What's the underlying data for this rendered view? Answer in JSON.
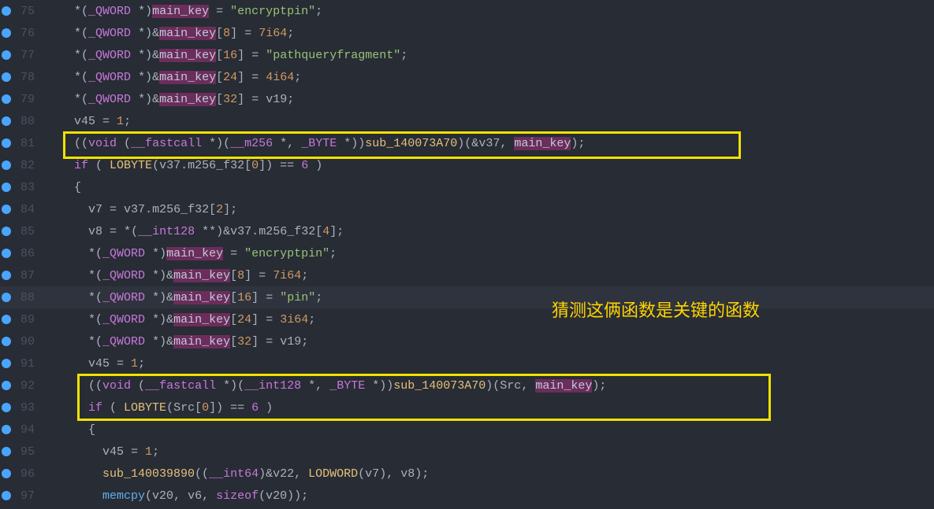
{
  "annotation_text": "猜测这俩函数是关键的函数",
  "lines": [
    {
      "n": 75,
      "indent": 2,
      "tokens": [
        {
          "t": "op",
          "v": "*"
        },
        {
          "t": "punc",
          "v": "("
        },
        {
          "t": "type",
          "v": "_QWORD"
        },
        {
          "t": "punc",
          "v": " "
        },
        {
          "t": "op",
          "v": "*"
        },
        {
          "t": "punc",
          "v": ")"
        },
        {
          "t": "hl1",
          "v": "main_key"
        },
        {
          "t": "op",
          "v": " = "
        },
        {
          "t": "str",
          "v": "\"encryptpin\""
        },
        {
          "t": "punc",
          "v": ";"
        }
      ]
    },
    {
      "n": 76,
      "indent": 2,
      "tokens": [
        {
          "t": "op",
          "v": "*"
        },
        {
          "t": "punc",
          "v": "("
        },
        {
          "t": "type",
          "v": "_QWORD"
        },
        {
          "t": "punc",
          "v": " "
        },
        {
          "t": "op",
          "v": "*"
        },
        {
          "t": "punc",
          "v": ")"
        },
        {
          "t": "op",
          "v": "&"
        },
        {
          "t": "hl1",
          "v": "main_key"
        },
        {
          "t": "punc",
          "v": "["
        },
        {
          "t": "num",
          "v": "8"
        },
        {
          "t": "punc",
          "v": "]"
        },
        {
          "t": "op",
          "v": " = "
        },
        {
          "t": "num",
          "v": "7i64"
        },
        {
          "t": "punc",
          "v": ";"
        }
      ]
    },
    {
      "n": 77,
      "indent": 2,
      "tokens": [
        {
          "t": "op",
          "v": "*"
        },
        {
          "t": "punc",
          "v": "("
        },
        {
          "t": "type",
          "v": "_QWORD"
        },
        {
          "t": "punc",
          "v": " "
        },
        {
          "t": "op",
          "v": "*"
        },
        {
          "t": "punc",
          "v": ")"
        },
        {
          "t": "op",
          "v": "&"
        },
        {
          "t": "hl1",
          "v": "main_key"
        },
        {
          "t": "punc",
          "v": "["
        },
        {
          "t": "num",
          "v": "16"
        },
        {
          "t": "punc",
          "v": "]"
        },
        {
          "t": "op",
          "v": " = "
        },
        {
          "t": "str",
          "v": "\"pathqueryfragment\""
        },
        {
          "t": "punc",
          "v": ";"
        }
      ]
    },
    {
      "n": 78,
      "indent": 2,
      "tokens": [
        {
          "t": "op",
          "v": "*"
        },
        {
          "t": "punc",
          "v": "("
        },
        {
          "t": "type",
          "v": "_QWORD"
        },
        {
          "t": "punc",
          "v": " "
        },
        {
          "t": "op",
          "v": "*"
        },
        {
          "t": "punc",
          "v": ")"
        },
        {
          "t": "op",
          "v": "&"
        },
        {
          "t": "hl1",
          "v": "main_key"
        },
        {
          "t": "punc",
          "v": "["
        },
        {
          "t": "num",
          "v": "24"
        },
        {
          "t": "punc",
          "v": "]"
        },
        {
          "t": "op",
          "v": " = "
        },
        {
          "t": "num",
          "v": "4i64"
        },
        {
          "t": "punc",
          "v": ";"
        }
      ]
    },
    {
      "n": 79,
      "indent": 2,
      "tokens": [
        {
          "t": "op",
          "v": "*"
        },
        {
          "t": "punc",
          "v": "("
        },
        {
          "t": "type",
          "v": "_QWORD"
        },
        {
          "t": "punc",
          "v": " "
        },
        {
          "t": "op",
          "v": "*"
        },
        {
          "t": "punc",
          "v": ")"
        },
        {
          "t": "op",
          "v": "&"
        },
        {
          "t": "hl1",
          "v": "main_key"
        },
        {
          "t": "punc",
          "v": "["
        },
        {
          "t": "num",
          "v": "32"
        },
        {
          "t": "punc",
          "v": "]"
        },
        {
          "t": "op",
          "v": " = "
        },
        {
          "t": "var",
          "v": "v19"
        },
        {
          "t": "punc",
          "v": ";"
        }
      ]
    },
    {
      "n": 80,
      "indent": 2,
      "tokens": [
        {
          "t": "var",
          "v": "v45"
        },
        {
          "t": "op",
          "v": " = "
        },
        {
          "t": "num",
          "v": "1"
        },
        {
          "t": "punc",
          "v": ";"
        }
      ]
    },
    {
      "n": 81,
      "indent": 2,
      "tokens": [
        {
          "t": "punc",
          "v": "(("
        },
        {
          "t": "kw",
          "v": "void"
        },
        {
          "t": "punc",
          "v": " ("
        },
        {
          "t": "kw",
          "v": "__fastcall"
        },
        {
          "t": "punc",
          "v": " "
        },
        {
          "t": "op",
          "v": "*"
        },
        {
          "t": "punc",
          "v": ")("
        },
        {
          "t": "type",
          "v": "__m256"
        },
        {
          "t": "punc",
          "v": " "
        },
        {
          "t": "op",
          "v": "*"
        },
        {
          "t": "punc",
          "v": ", "
        },
        {
          "t": "type",
          "v": "_BYTE"
        },
        {
          "t": "punc",
          "v": " "
        },
        {
          "t": "op",
          "v": "*"
        },
        {
          "t": "punc",
          "v": "))"
        },
        {
          "t": "gfunc",
          "v": "sub_140073A70"
        },
        {
          "t": "punc",
          "v": ")("
        },
        {
          "t": "op",
          "v": "&"
        },
        {
          "t": "var",
          "v": "v37"
        },
        {
          "t": "punc",
          "v": ", "
        },
        {
          "t": "hl1",
          "v": "main_key"
        },
        {
          "t": "punc",
          "v": ");"
        }
      ]
    },
    {
      "n": 82,
      "indent": 2,
      "tokens": [
        {
          "t": "kw",
          "v": "if"
        },
        {
          "t": "punc",
          "v": " ( "
        },
        {
          "t": "macro",
          "v": "LOBYTE"
        },
        {
          "t": "punc",
          "v": "("
        },
        {
          "t": "var",
          "v": "v37"
        },
        {
          "t": "punc",
          "v": "."
        },
        {
          "t": "var",
          "v": "m256_f32"
        },
        {
          "t": "punc",
          "v": "["
        },
        {
          "t": "num",
          "v": "0"
        },
        {
          "t": "punc",
          "v": "])"
        },
        {
          "t": "op",
          "v": " == "
        },
        {
          "t": "eq6",
          "v": "6"
        },
        {
          "t": "punc",
          "v": " )"
        }
      ]
    },
    {
      "n": 83,
      "indent": 2,
      "tokens": [
        {
          "t": "punc",
          "v": "{"
        }
      ]
    },
    {
      "n": 84,
      "indent": 3,
      "tokens": [
        {
          "t": "var",
          "v": "v7"
        },
        {
          "t": "op",
          "v": " = "
        },
        {
          "t": "var",
          "v": "v37"
        },
        {
          "t": "punc",
          "v": "."
        },
        {
          "t": "var",
          "v": "m256_f32"
        },
        {
          "t": "punc",
          "v": "["
        },
        {
          "t": "num",
          "v": "2"
        },
        {
          "t": "punc",
          "v": "];"
        }
      ]
    },
    {
      "n": 85,
      "indent": 3,
      "tokens": [
        {
          "t": "var",
          "v": "v8"
        },
        {
          "t": "op",
          "v": " = "
        },
        {
          "t": "op",
          "v": "*"
        },
        {
          "t": "punc",
          "v": "("
        },
        {
          "t": "type",
          "v": "__int128"
        },
        {
          "t": "punc",
          "v": " "
        },
        {
          "t": "op",
          "v": "**"
        },
        {
          "t": "punc",
          "v": ")"
        },
        {
          "t": "op",
          "v": "&"
        },
        {
          "t": "var",
          "v": "v37"
        },
        {
          "t": "punc",
          "v": "."
        },
        {
          "t": "var",
          "v": "m256_f32"
        },
        {
          "t": "punc",
          "v": "["
        },
        {
          "t": "num",
          "v": "4"
        },
        {
          "t": "punc",
          "v": "];"
        }
      ]
    },
    {
      "n": 86,
      "indent": 3,
      "tokens": [
        {
          "t": "op",
          "v": "*"
        },
        {
          "t": "punc",
          "v": "("
        },
        {
          "t": "type",
          "v": "_QWORD"
        },
        {
          "t": "punc",
          "v": " "
        },
        {
          "t": "op",
          "v": "*"
        },
        {
          "t": "punc",
          "v": ")"
        },
        {
          "t": "hl1",
          "v": "main_key"
        },
        {
          "t": "op",
          "v": " = "
        },
        {
          "t": "str",
          "v": "\"encryptpin\""
        },
        {
          "t": "punc",
          "v": ";"
        }
      ]
    },
    {
      "n": 87,
      "indent": 3,
      "tokens": [
        {
          "t": "op",
          "v": "*"
        },
        {
          "t": "punc",
          "v": "("
        },
        {
          "t": "type",
          "v": "_QWORD"
        },
        {
          "t": "punc",
          "v": " "
        },
        {
          "t": "op",
          "v": "*"
        },
        {
          "t": "punc",
          "v": ")"
        },
        {
          "t": "op",
          "v": "&"
        },
        {
          "t": "hl1",
          "v": "main_key"
        },
        {
          "t": "punc",
          "v": "["
        },
        {
          "t": "num",
          "v": "8"
        },
        {
          "t": "punc",
          "v": "]"
        },
        {
          "t": "op",
          "v": " = "
        },
        {
          "t": "num",
          "v": "7i64"
        },
        {
          "t": "punc",
          "v": ";"
        }
      ]
    },
    {
      "n": 88,
      "indent": 3,
      "current": true,
      "tokens": [
        {
          "t": "op",
          "v": "*"
        },
        {
          "t": "punc",
          "v": "("
        },
        {
          "t": "type",
          "v": "_QWORD"
        },
        {
          "t": "punc",
          "v": " "
        },
        {
          "t": "op",
          "v": "*"
        },
        {
          "t": "punc",
          "v": ")"
        },
        {
          "t": "op",
          "v": "&"
        },
        {
          "t": "hl1",
          "v": "main_key"
        },
        {
          "t": "punc",
          "v": "["
        },
        {
          "t": "num",
          "v": "16"
        },
        {
          "t": "punc",
          "v": "]"
        },
        {
          "t": "op",
          "v": " = "
        },
        {
          "t": "str",
          "v": "\"pin\""
        },
        {
          "t": "punc",
          "v": ";"
        }
      ]
    },
    {
      "n": 89,
      "indent": 3,
      "tokens": [
        {
          "t": "op",
          "v": "*"
        },
        {
          "t": "punc",
          "v": "("
        },
        {
          "t": "type",
          "v": "_QWORD"
        },
        {
          "t": "punc",
          "v": " "
        },
        {
          "t": "op",
          "v": "*"
        },
        {
          "t": "punc",
          "v": ")"
        },
        {
          "t": "op",
          "v": "&"
        },
        {
          "t": "hl1",
          "v": "main_key"
        },
        {
          "t": "punc",
          "v": "["
        },
        {
          "t": "num",
          "v": "24"
        },
        {
          "t": "punc",
          "v": "]"
        },
        {
          "t": "op",
          "v": " = "
        },
        {
          "t": "num",
          "v": "3i64"
        },
        {
          "t": "punc",
          "v": ";"
        }
      ]
    },
    {
      "n": 90,
      "indent": 3,
      "tokens": [
        {
          "t": "op",
          "v": "*"
        },
        {
          "t": "punc",
          "v": "("
        },
        {
          "t": "type",
          "v": "_QWORD"
        },
        {
          "t": "punc",
          "v": " "
        },
        {
          "t": "op",
          "v": "*"
        },
        {
          "t": "punc",
          "v": ")"
        },
        {
          "t": "op",
          "v": "&"
        },
        {
          "t": "hl1",
          "v": "main_key"
        },
        {
          "t": "punc",
          "v": "["
        },
        {
          "t": "num",
          "v": "32"
        },
        {
          "t": "punc",
          "v": "]"
        },
        {
          "t": "op",
          "v": " = "
        },
        {
          "t": "var",
          "v": "v19"
        },
        {
          "t": "punc",
          "v": ";"
        }
      ]
    },
    {
      "n": 91,
      "indent": 3,
      "tokens": [
        {
          "t": "var",
          "v": "v45"
        },
        {
          "t": "op",
          "v": " = "
        },
        {
          "t": "num",
          "v": "1"
        },
        {
          "t": "punc",
          "v": ";"
        }
      ]
    },
    {
      "n": 92,
      "indent": 3,
      "tokens": [
        {
          "t": "punc",
          "v": "(("
        },
        {
          "t": "kw",
          "v": "void"
        },
        {
          "t": "punc",
          "v": " ("
        },
        {
          "t": "kw",
          "v": "__fastcall"
        },
        {
          "t": "punc",
          "v": " "
        },
        {
          "t": "op",
          "v": "*"
        },
        {
          "t": "punc",
          "v": ")("
        },
        {
          "t": "type",
          "v": "__int128"
        },
        {
          "t": "punc",
          "v": " "
        },
        {
          "t": "op",
          "v": "*"
        },
        {
          "t": "punc",
          "v": ", "
        },
        {
          "t": "type",
          "v": "_BYTE"
        },
        {
          "t": "punc",
          "v": " "
        },
        {
          "t": "op",
          "v": "*"
        },
        {
          "t": "punc",
          "v": "))"
        },
        {
          "t": "gfunc",
          "v": "sub_140073A70"
        },
        {
          "t": "punc",
          "v": ")("
        },
        {
          "t": "var",
          "v": "Src"
        },
        {
          "t": "punc",
          "v": ", "
        },
        {
          "t": "hl1",
          "v": "main_key"
        },
        {
          "t": "punc",
          "v": ");"
        }
      ]
    },
    {
      "n": 93,
      "indent": 3,
      "tokens": [
        {
          "t": "kw",
          "v": "if"
        },
        {
          "t": "punc",
          "v": " ( "
        },
        {
          "t": "macro",
          "v": "LOBYTE"
        },
        {
          "t": "punc",
          "v": "("
        },
        {
          "t": "var",
          "v": "Src"
        },
        {
          "t": "punc",
          "v": "["
        },
        {
          "t": "num",
          "v": "0"
        },
        {
          "t": "punc",
          "v": "])"
        },
        {
          "t": "op",
          "v": " == "
        },
        {
          "t": "eq6",
          "v": "6"
        },
        {
          "t": "punc",
          "v": " )"
        }
      ]
    },
    {
      "n": 94,
      "indent": 3,
      "tokens": [
        {
          "t": "punc",
          "v": "{"
        }
      ]
    },
    {
      "n": 95,
      "indent": 4,
      "tokens": [
        {
          "t": "var",
          "v": "v45"
        },
        {
          "t": "op",
          "v": " = "
        },
        {
          "t": "num",
          "v": "1"
        },
        {
          "t": "punc",
          "v": ";"
        }
      ]
    },
    {
      "n": 96,
      "indent": 4,
      "tokens": [
        {
          "t": "gfunc",
          "v": "sub_140039890"
        },
        {
          "t": "punc",
          "v": "(("
        },
        {
          "t": "type",
          "v": "__int64"
        },
        {
          "t": "punc",
          "v": ")"
        },
        {
          "t": "op",
          "v": "&"
        },
        {
          "t": "var",
          "v": "v22"
        },
        {
          "t": "punc",
          "v": ", "
        },
        {
          "t": "macro",
          "v": "LODWORD"
        },
        {
          "t": "punc",
          "v": "("
        },
        {
          "t": "var",
          "v": "v7"
        },
        {
          "t": "punc",
          "v": "), "
        },
        {
          "t": "var",
          "v": "v8"
        },
        {
          "t": "punc",
          "v": ");"
        }
      ]
    },
    {
      "n": 97,
      "indent": 4,
      "tokens": [
        {
          "t": "func",
          "v": "memcpy"
        },
        {
          "t": "punc",
          "v": "("
        },
        {
          "t": "var",
          "v": "v20"
        },
        {
          "t": "punc",
          "v": ", "
        },
        {
          "t": "var",
          "v": "v6"
        },
        {
          "t": "punc",
          "v": ", "
        },
        {
          "t": "kw",
          "v": "sizeof"
        },
        {
          "t": "punc",
          "v": "("
        },
        {
          "t": "var",
          "v": "v20"
        },
        {
          "t": "punc",
          "v": "));"
        }
      ]
    }
  ]
}
